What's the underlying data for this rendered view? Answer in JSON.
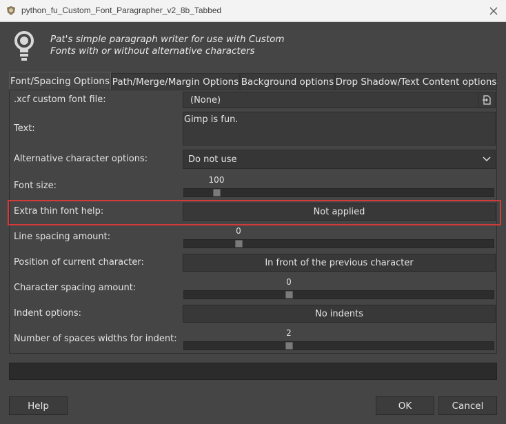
{
  "window": {
    "title": "python_fu_Custom_Font_Paragrapher_v2_8b_Tabbed"
  },
  "header": {
    "line1": "Pat's simple paragraph writer for use with Custom",
    "line2": "Fonts with or without alternative characters"
  },
  "tabs": [
    {
      "label": "Font/Spacing Options",
      "active": true
    },
    {
      "label": "Path/Merge/Margin Options"
    },
    {
      "label": "Background options"
    },
    {
      "label": "Drop Shadow/Text Content options"
    }
  ],
  "fields": {
    "xcf_font_label": ".xcf custom font file:",
    "xcf_font_value": "(None)",
    "text_label": "Text:",
    "text_value": "Gimp is fun.",
    "alt_char_label": "Alternative character options:",
    "alt_char_value": "Do not use",
    "font_size_label": "Font size:",
    "font_size_value": "100",
    "thin_help_label": "Extra thin font help:",
    "thin_help_value": "Not applied",
    "line_spacing_label": "Line spacing amount:",
    "line_spacing_value": "0",
    "position_label": "Position of current character:",
    "position_value": "In front of the previous character",
    "char_spacing_label": "Character spacing amount:",
    "char_spacing_value": "0",
    "indent_label": "Indent options:",
    "indent_value": "No indents",
    "spaces_label": "Number of spaces widths for indent:",
    "spaces_value": "2"
  },
  "buttons": {
    "help": "Help",
    "ok": "OK",
    "cancel": "Cancel"
  },
  "colors": {
    "background": "#454545",
    "highlight": "#d33a3a"
  }
}
